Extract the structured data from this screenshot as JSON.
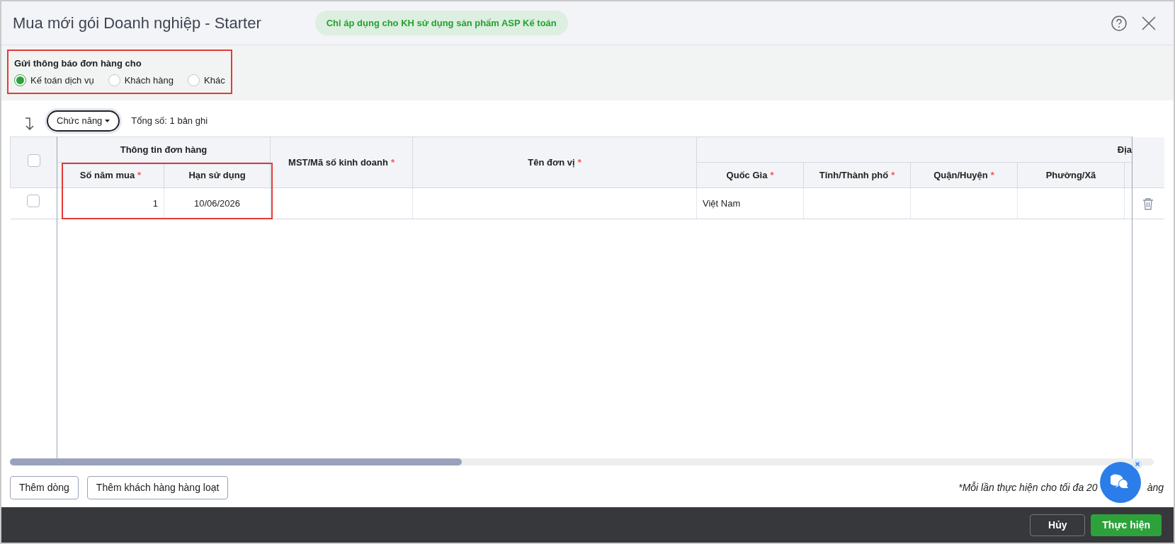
{
  "window": {
    "title": "Mua mới gói Doanh nghiệp - Starter",
    "badge": "Chỉ áp dụng cho KH sử dụng sản phẩm ASP Kế toán"
  },
  "notify": {
    "label": "Gửi thông báo đơn hàng cho",
    "options": [
      {
        "label": "Kế toán dịch vụ",
        "selected": true
      },
      {
        "label": "Khách hàng",
        "selected": false
      },
      {
        "label": "Khác",
        "selected": false
      }
    ]
  },
  "toolbar": {
    "function_button": "Chức năng",
    "total": "Tổng số: 1 bản ghi"
  },
  "required_mark": "*",
  "table": {
    "groups": [
      {
        "label": "Thông tin đơn hàng",
        "columns": [
          {
            "label": "Số năm mua",
            "required": true
          },
          {
            "label": "Hạn sử dụng",
            "required": false
          }
        ]
      },
      {
        "label": "MST/Mã số kinh doanh",
        "required": true
      },
      {
        "label": "Tên đơn vị",
        "required": true
      },
      {
        "label": "Địa",
        "columns": [
          {
            "label": "Quốc Gia",
            "required": true
          },
          {
            "label": "Tỉnh/Thành phố",
            "required": true
          },
          {
            "label": "Quận/Huyện",
            "required": true
          },
          {
            "label": "Phường/Xã",
            "required": false
          }
        ]
      }
    ],
    "rows": [
      {
        "checked": false,
        "cells": [
          "1",
          "10/06/2026",
          "",
          "",
          "Việt Nam",
          "",
          "",
          ""
        ]
      }
    ],
    "header_checked": false
  },
  "buttons": {
    "add_row": "Thêm dòng",
    "add_bulk": "Thêm khách hàng hàng loạt"
  },
  "note": {
    "before": "*Mỗi lần thực hiện cho tối đa 20",
    "after": "àng"
  },
  "footer": {
    "cancel": "Hủy",
    "submit": "Thực hiện"
  }
}
